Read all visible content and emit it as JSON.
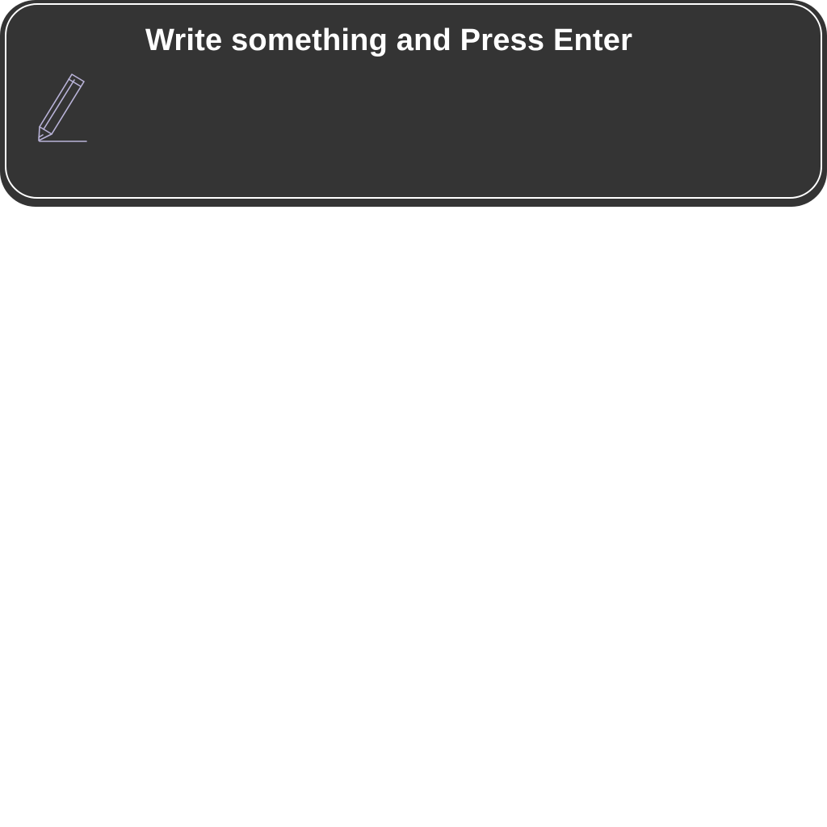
{
  "editor": {
    "prompt": "Write something and Press Enter",
    "input_value": "",
    "icon": "pencil-icon",
    "colors": {
      "panel_background": "#343434",
      "panel_border": "#ffffff",
      "prompt_text": "#ffffff",
      "icon_stroke": "#b9b3d8"
    }
  }
}
